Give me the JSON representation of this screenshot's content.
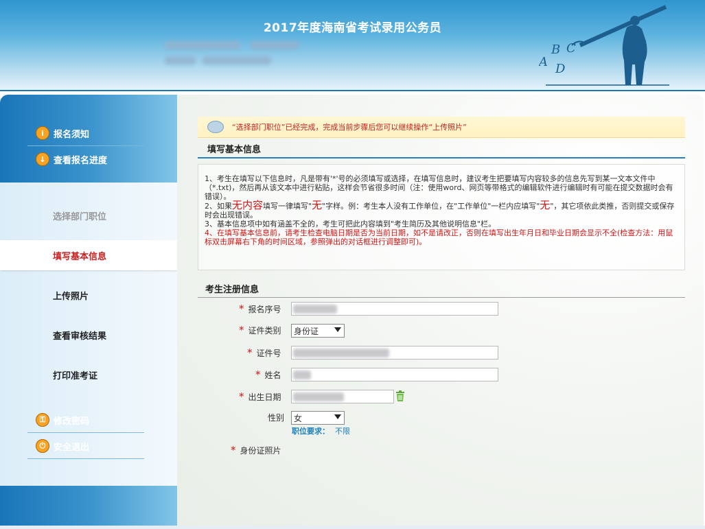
{
  "header": {
    "title": "2017年度海南省考试录用公务员"
  },
  "nav": {
    "top_items": [
      {
        "label": "报名须知",
        "icon": "info-icon"
      },
      {
        "label": "查看报名进度",
        "icon": "download-icon"
      }
    ],
    "steps": [
      {
        "label": "选择部门职位",
        "state": "disabled"
      },
      {
        "label": "填写基本信息",
        "state": "active"
      },
      {
        "label": "上传照片",
        "state": "normal"
      },
      {
        "label": "查看审核结果",
        "state": "normal"
      },
      {
        "label": "打印准考证",
        "state": "normal"
      }
    ],
    "bottom_items": [
      {
        "label": "修改密码",
        "icon": "key-icon"
      },
      {
        "label": "安全退出",
        "icon": "power-icon"
      }
    ]
  },
  "notice": {
    "text": "“选择部门职位”已经完成，完成当前步骤后您可以继续操作“上传照片”"
  },
  "basic_info": {
    "title": "填写基本信息",
    "p1": "1、考生在填写以下信息时，凡是带有'*'号的必须填写或选择，在填写信息时，建议考生把要填写内容较多的信息先写到某一文本文件中（*.txt)，然后再从该文本中进行粘贴，这样会节省很多时间（注：使用word、网页等带格式的编辑软件进行编辑时有可能在提交数据时会有错误）。",
    "p2_a": "2、如果",
    "p2_b": "无内容",
    "p2_c": "填写一律填写\"",
    "p2_d": "无",
    "p2_e": "\"字样。例：考生本人没有工作单位，在\"工作单位\"一栏内应填写\"",
    "p2_f": "无",
    "p2_g": "\"，其它项依此类推，否则提交或保存时会出现错误。",
    "p3": "3、基本信息项中如有涵盖不全的，考生可把此内容填到\"考生简历及其他说明信息\"栏。",
    "p4": "4、在填写基本信息前，请考生检查电脑日期是否为当前日期，如不是请改正，否则在填写出生年月日和毕业日期会显示不全(检查方法：用鼠标双击屏幕右下角的时间区域，参照弹出的对话框进行调整即可)。"
  },
  "registration": {
    "title": "考生注册信息",
    "fields": {
      "reg_no": "报名序号",
      "id_type": "证件类别",
      "id_no": "证件号",
      "name": "姓名",
      "birth": "出生日期",
      "gender": "性别",
      "id_photo": "身份证照片"
    },
    "id_type_value": "身份证",
    "gender_value": "女",
    "requirement_label": "职位要求：",
    "requirement_value": "不限",
    "required_mark": "*"
  }
}
